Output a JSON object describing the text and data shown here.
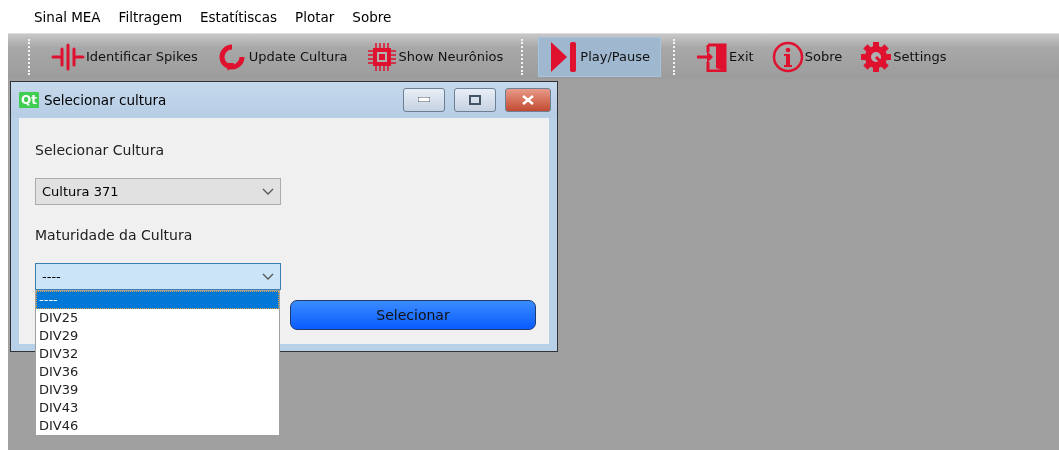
{
  "menu": [
    "Sinal MEA",
    "Filtragem",
    "Estatítiscas",
    "Plotar",
    "Sobre"
  ],
  "toolbar": [
    {
      "kind": "spikes",
      "label": "Identificar Spikes",
      "selected": false
    },
    {
      "kind": "refresh",
      "label": "Update Cultura",
      "selected": false
    },
    {
      "kind": "chip",
      "label": "Show Neurônios",
      "selected": false
    },
    {
      "kind": "separator"
    },
    {
      "kind": "play",
      "label": "Play/Pause",
      "selected": true
    },
    {
      "kind": "separator"
    },
    {
      "kind": "exit",
      "label": "Exit",
      "selected": false
    },
    {
      "kind": "info",
      "label": "Sobre",
      "selected": false
    },
    {
      "kind": "gear",
      "label": "Settings",
      "selected": false
    }
  ],
  "dialog": {
    "title": "Selecionar cultura",
    "logo": "Qt",
    "culture_label": "Selecionar Cultura",
    "culture_value": "Cultura 371",
    "maturity_label": "Maturidade da Cultura",
    "maturity_value": "----",
    "button": "Selecionar",
    "options": [
      {
        "label": "----",
        "selected": true
      },
      {
        "label": "DIV25",
        "selected": false
      },
      {
        "label": "DIV29",
        "selected": false
      },
      {
        "label": "DIV32",
        "selected": false
      },
      {
        "label": "DIV36",
        "selected": false
      },
      {
        "label": "DIV39",
        "selected": false
      },
      {
        "label": "DIV43",
        "selected": false
      },
      {
        "label": "DIV46",
        "selected": false
      }
    ]
  }
}
